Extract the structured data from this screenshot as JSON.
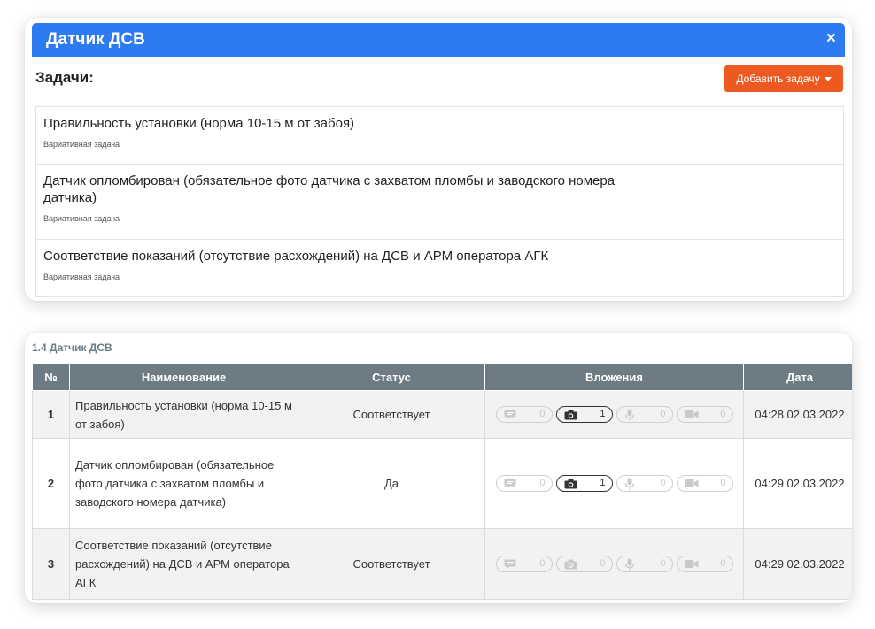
{
  "modal": {
    "title": "Датчик ДСВ",
    "close_glyph": "×",
    "tasks_heading": "Задачи:",
    "add_task_label": "Добавить задачу",
    "accent_color": "#2d7bf0",
    "button_color": "#ec5a22",
    "tasks": [
      {
        "title": "Правильность установки (норма 10-15 м от забоя)",
        "subtitle": "Вариативная задача"
      },
      {
        "title": "Датчик опломбирован (обязательное фото датчика с захватом пломбы и заводского номера датчика)",
        "subtitle": "Вариативная задача"
      },
      {
        "title": "Соответствие показаний (отсутствие расхождений) на ДСВ и АРМ оператора АГК",
        "subtitle": "Вариативная задача"
      }
    ]
  },
  "report": {
    "section_title": "1.4 Датчик ДСВ",
    "columns": [
      "№",
      "Наименование",
      "Статус",
      "Вложения",
      "Дата"
    ],
    "header_color": "#6d7b84",
    "rows": [
      {
        "num": "1",
        "name": "Правильность установки (норма 10-15 м от забоя)",
        "status": "Соответствует",
        "attachments": {
          "comments": "0",
          "photos": "1",
          "audio": "0",
          "video": "0"
        },
        "date": "04:28 02.03.2022"
      },
      {
        "num": "2",
        "name": "Датчик опломбирован (обязательное фото датчика с захватом пломбы и заводского номера датчика)",
        "status": "Да",
        "attachments": {
          "comments": "0",
          "photos": "1",
          "audio": "0",
          "video": "0"
        },
        "date": "04:29 02.03.2022"
      },
      {
        "num": "3",
        "name": "Соответствие показаний (отсутствие расхождений) на ДСВ и АРМ оператора АГК",
        "status": "Соответствует",
        "attachments": {
          "comments": "0",
          "photos": "0",
          "audio": "0",
          "video": "0"
        },
        "date": "04:29 02.03.2022"
      }
    ],
    "attachment_icons": [
      "comment-icon",
      "camera-icon",
      "microphone-icon",
      "video-icon"
    ]
  }
}
